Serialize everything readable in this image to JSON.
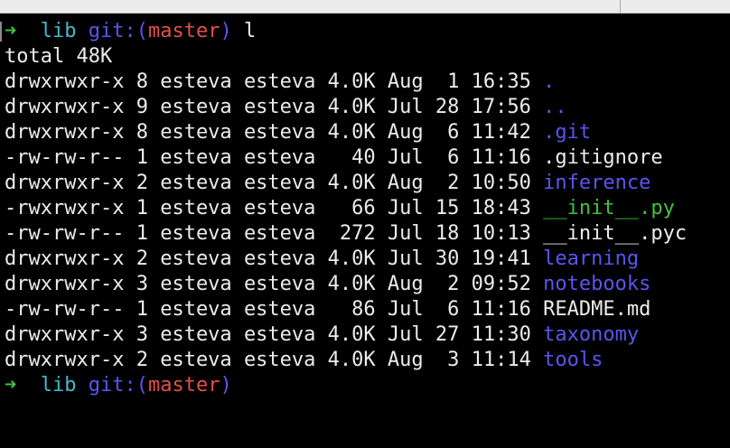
{
  "prompt_top": {
    "arrow": "➜",
    "dir": "lib",
    "git_open": "git:(",
    "branch": "master",
    "git_close": ")",
    "command": "l"
  },
  "total_line": "total 48K",
  "entries": [
    {
      "perms": "drwxrwxr-x",
      "links": "8",
      "owner": "esteva",
      "group": "esteva",
      "size": "4.0K",
      "month": "Aug",
      "day": "1",
      "time": "16:35",
      "name": ".",
      "type": "dir"
    },
    {
      "perms": "drwxrwxr-x",
      "links": "9",
      "owner": "esteva",
      "group": "esteva",
      "size": "4.0K",
      "month": "Jul",
      "day": "28",
      "time": "17:56",
      "name": "..",
      "type": "dir"
    },
    {
      "perms": "drwxrwxr-x",
      "links": "8",
      "owner": "esteva",
      "group": "esteva",
      "size": "4.0K",
      "month": "Aug",
      "day": "6",
      "time": "11:42",
      "name": ".git",
      "type": "dir"
    },
    {
      "perms": "-rw-rw-r--",
      "links": "1",
      "owner": "esteva",
      "group": "esteva",
      "size": "40",
      "month": "Jul",
      "day": "6",
      "time": "11:16",
      "name": ".gitignore",
      "type": "file"
    },
    {
      "perms": "drwxrwxr-x",
      "links": "2",
      "owner": "esteva",
      "group": "esteva",
      "size": "4.0K",
      "month": "Aug",
      "day": "2",
      "time": "10:50",
      "name": "inference",
      "type": "dir"
    },
    {
      "perms": "-rwxrwxr-x",
      "links": "1",
      "owner": "esteva",
      "group": "esteva",
      "size": "66",
      "month": "Jul",
      "day": "15",
      "time": "18:43",
      "name": "__init__.py",
      "type": "exec"
    },
    {
      "perms": "-rw-rw-r--",
      "links": "1",
      "owner": "esteva",
      "group": "esteva",
      "size": "272",
      "month": "Jul",
      "day": "18",
      "time": "10:13",
      "name": "__init__.pyc",
      "type": "file"
    },
    {
      "perms": "drwxrwxr-x",
      "links": "2",
      "owner": "esteva",
      "group": "esteva",
      "size": "4.0K",
      "month": "Jul",
      "day": "30",
      "time": "19:41",
      "name": "learning",
      "type": "dir"
    },
    {
      "perms": "drwxrwxr-x",
      "links": "3",
      "owner": "esteva",
      "group": "esteva",
      "size": "4.0K",
      "month": "Aug",
      "day": "2",
      "time": "09:52",
      "name": "notebooks",
      "type": "dir"
    },
    {
      "perms": "-rw-rw-r--",
      "links": "1",
      "owner": "esteva",
      "group": "esteva",
      "size": "86",
      "month": "Jul",
      "day": "6",
      "time": "11:16",
      "name": "README.md",
      "type": "file"
    },
    {
      "perms": "drwxrwxr-x",
      "links": "3",
      "owner": "esteva",
      "group": "esteva",
      "size": "4.0K",
      "month": "Jul",
      "day": "27",
      "time": "11:30",
      "name": "taxonomy",
      "type": "dir"
    },
    {
      "perms": "drwxrwxr-x",
      "links": "2",
      "owner": "esteva",
      "group": "esteva",
      "size": "4.0K",
      "month": "Aug",
      "day": "3",
      "time": "11:14",
      "name": "tools",
      "type": "dir"
    }
  ],
  "prompt_bottom": {
    "arrow": "➜",
    "dir": "lib",
    "git_open": "git:(",
    "branch": "master",
    "git_close": ")"
  },
  "colors": {
    "background": "#000000",
    "text": "#ececec",
    "directory": "#5a55f0",
    "executable": "#3fc33f",
    "arrow": "#3fc33f",
    "prompt_dir": "#45b8c8",
    "git_label": "#5a55f0",
    "branch": "#e0514b"
  }
}
